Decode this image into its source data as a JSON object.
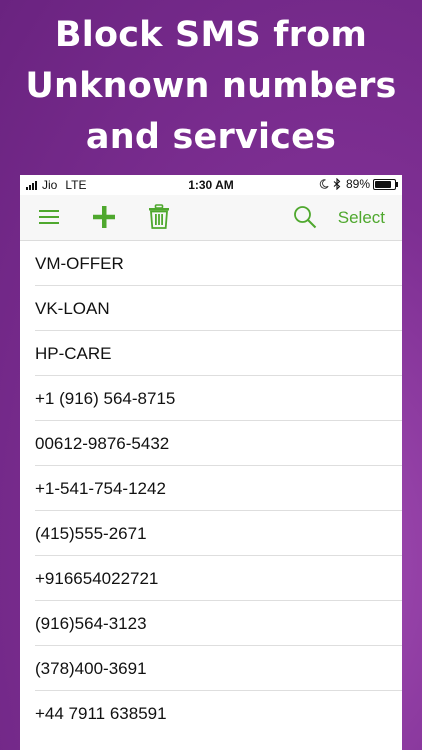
{
  "headline": {
    "line1": "Block SMS from",
    "line2": "Unknown numbers",
    "line3": "and services"
  },
  "status_bar": {
    "carrier": "Jio",
    "network": "LTE",
    "time": "1:30 AM",
    "battery_text": "89%",
    "battery_level": 0.89
  },
  "toolbar": {
    "menu_icon": "hamburger-menu-icon",
    "add_icon": "plus-icon",
    "delete_icon": "trash-icon",
    "search_icon": "search-icon",
    "select_label": "Select",
    "accent_color": "#4fa82e"
  },
  "blocked_list": [
    "VM-OFFER",
    "VK-LOAN",
    "HP-CARE",
    "+1 (916) 564-8715",
    "00612-9876-5432",
    "+1-541-754-1242",
    "(415)555-2671",
    "+916654022721",
    "(916)564-3123",
    "(378)400-3691",
    "+44 7911 638591"
  ],
  "colors": {
    "background": "#7e2f93",
    "headline_text": "#ffffff"
  }
}
